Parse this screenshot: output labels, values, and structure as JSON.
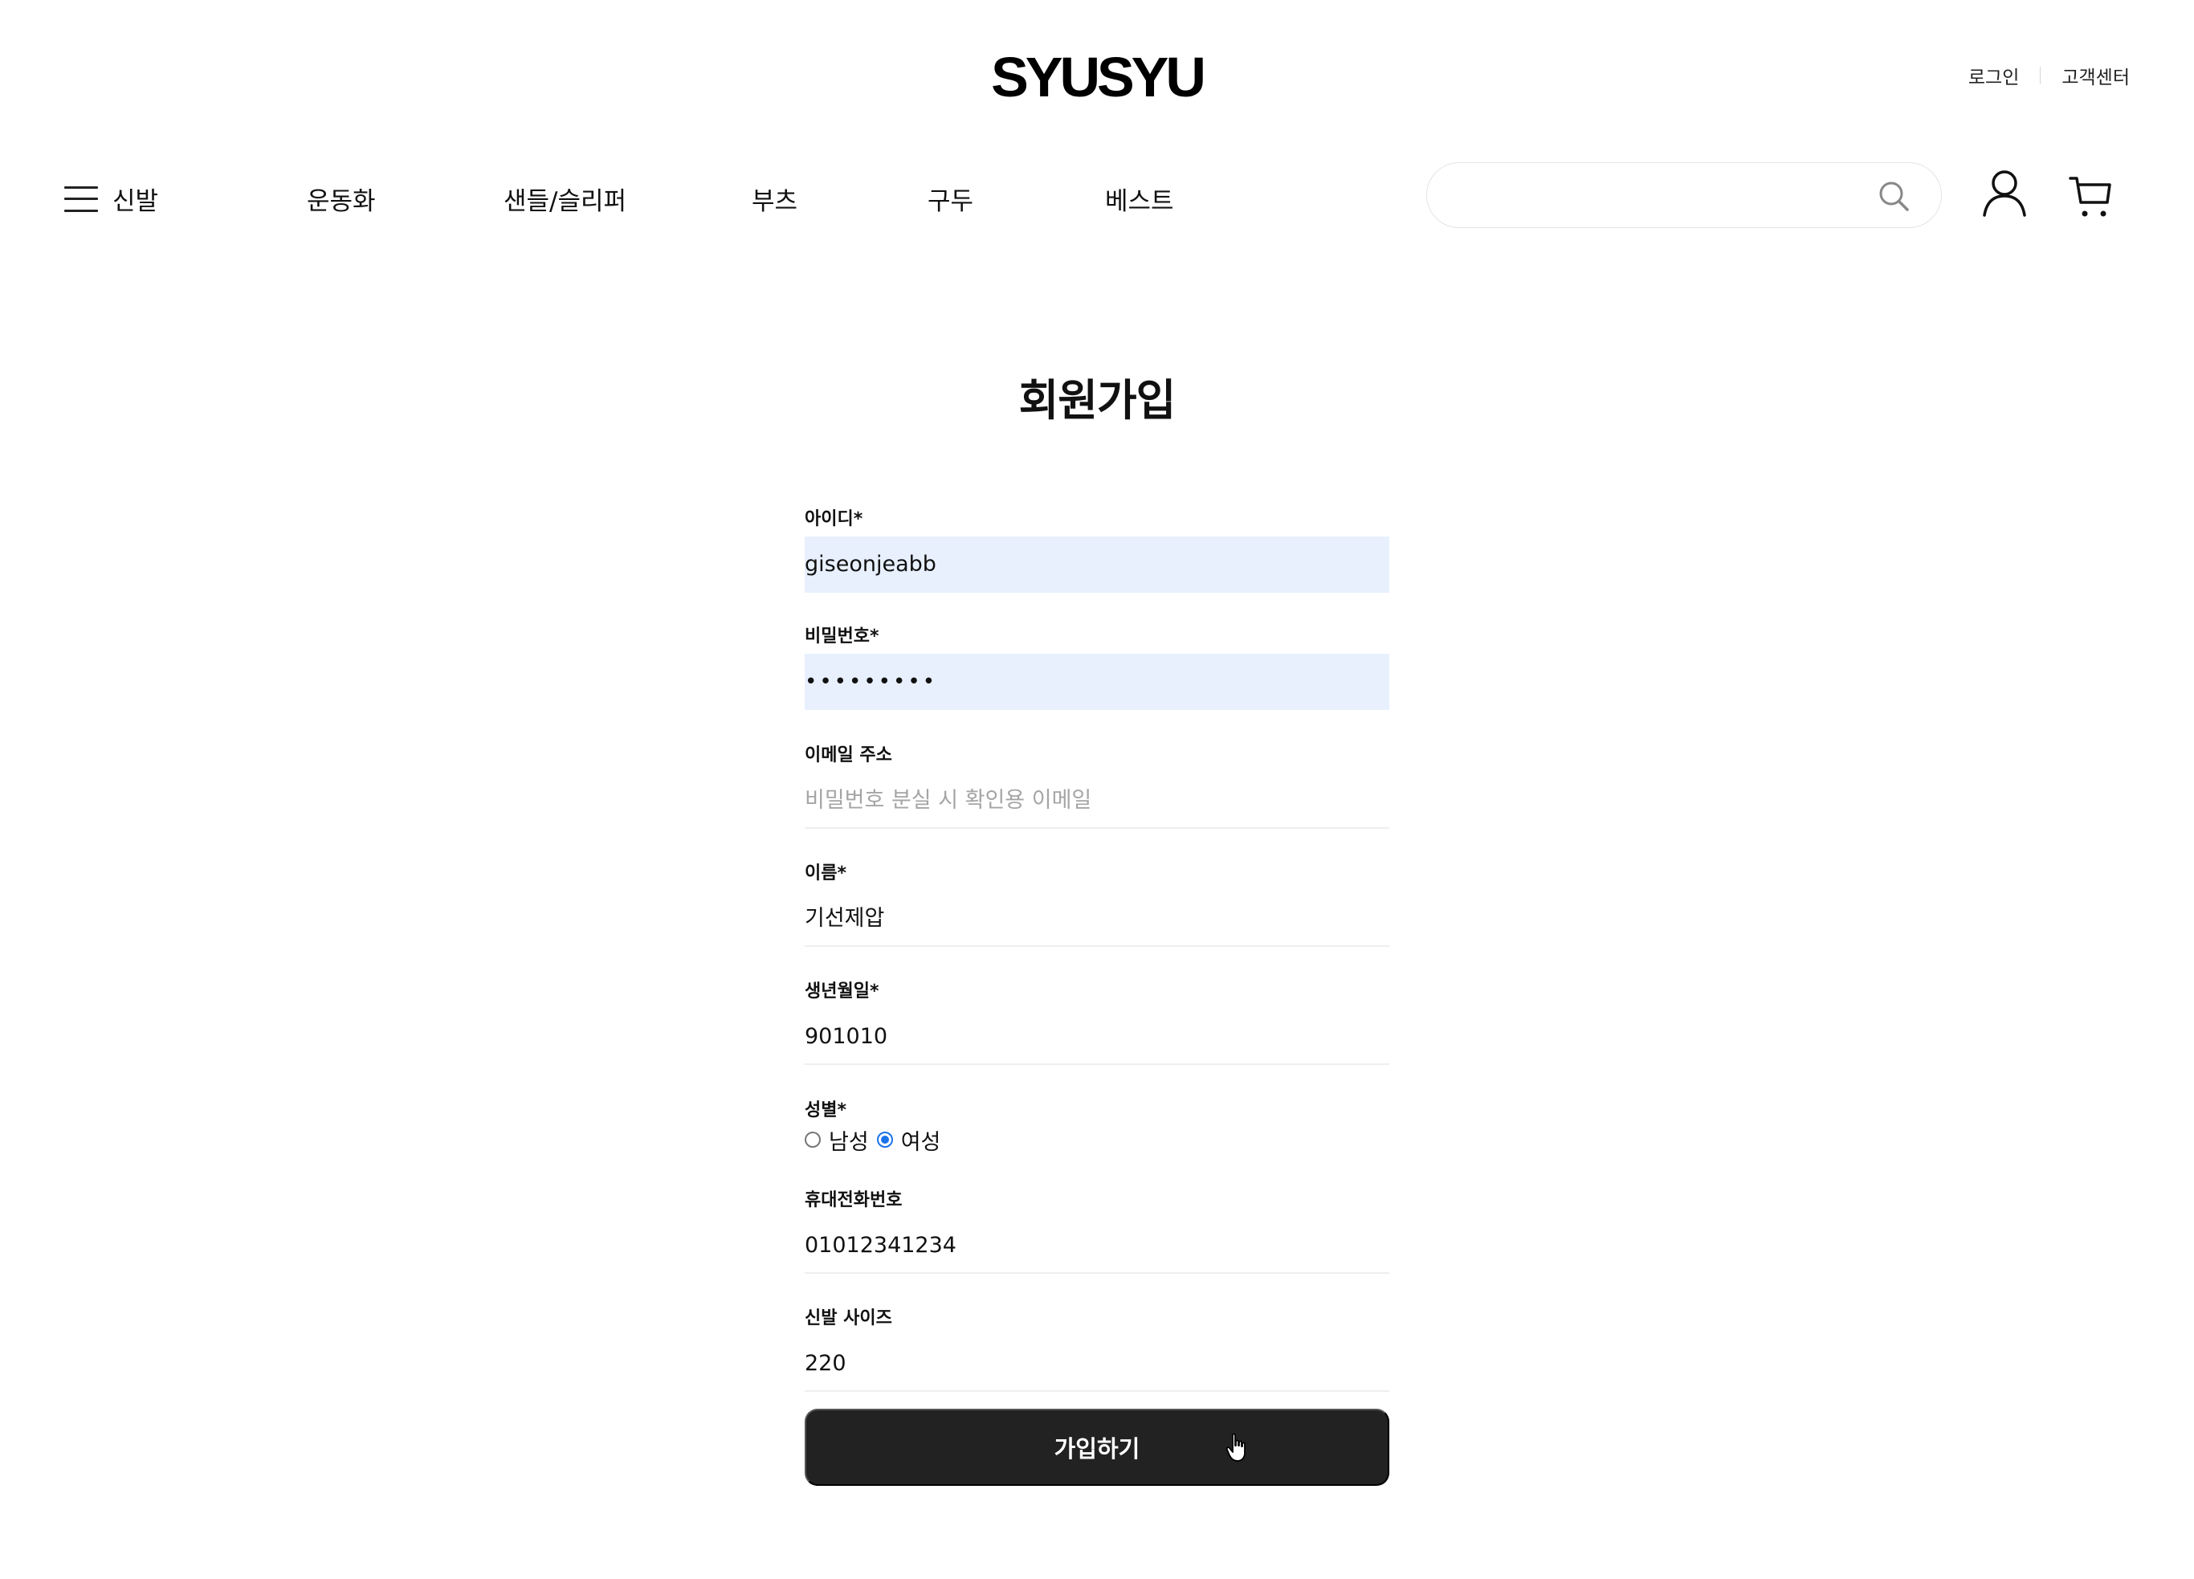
{
  "header": {
    "logo": "SYUSYU",
    "util_links": [
      "로그인",
      "고객센터"
    ]
  },
  "nav": {
    "menu_label": "신발",
    "items": [
      "운동화",
      "샌들/슬리퍼",
      "부츠",
      "구두",
      "베스트"
    ]
  },
  "search": {
    "value": "",
    "icon": "search-icon"
  },
  "icons": {
    "user": "user-icon",
    "cart": "cart-icon",
    "menu": "hamburger-icon"
  },
  "signup": {
    "title": "회원가입",
    "fields": {
      "id": {
        "label": "아이디*",
        "value": "giseonjeabb"
      },
      "password": {
        "label": "비밀번호*",
        "value": "•••••••••"
      },
      "email": {
        "label": "이메일 주소",
        "placeholder": "비밀번호 분실 시 확인용 이메일"
      },
      "name": {
        "label": "이름*",
        "value": "기선제압"
      },
      "birth": {
        "label": "생년월일*",
        "value": "901010"
      },
      "gender": {
        "label": "성별*",
        "options": [
          "남성",
          "여성"
        ],
        "selected": "여성"
      },
      "phone": {
        "label": "휴대전화번호",
        "value": "01012341234"
      },
      "shoe_size": {
        "label": "신발 사이즈",
        "value": "220"
      }
    },
    "submit_label": "가입하기"
  },
  "colors": {
    "autofill_bg": "#e8f0fe",
    "button_bg": "#222222",
    "radio_accent": "#1a73e8"
  }
}
